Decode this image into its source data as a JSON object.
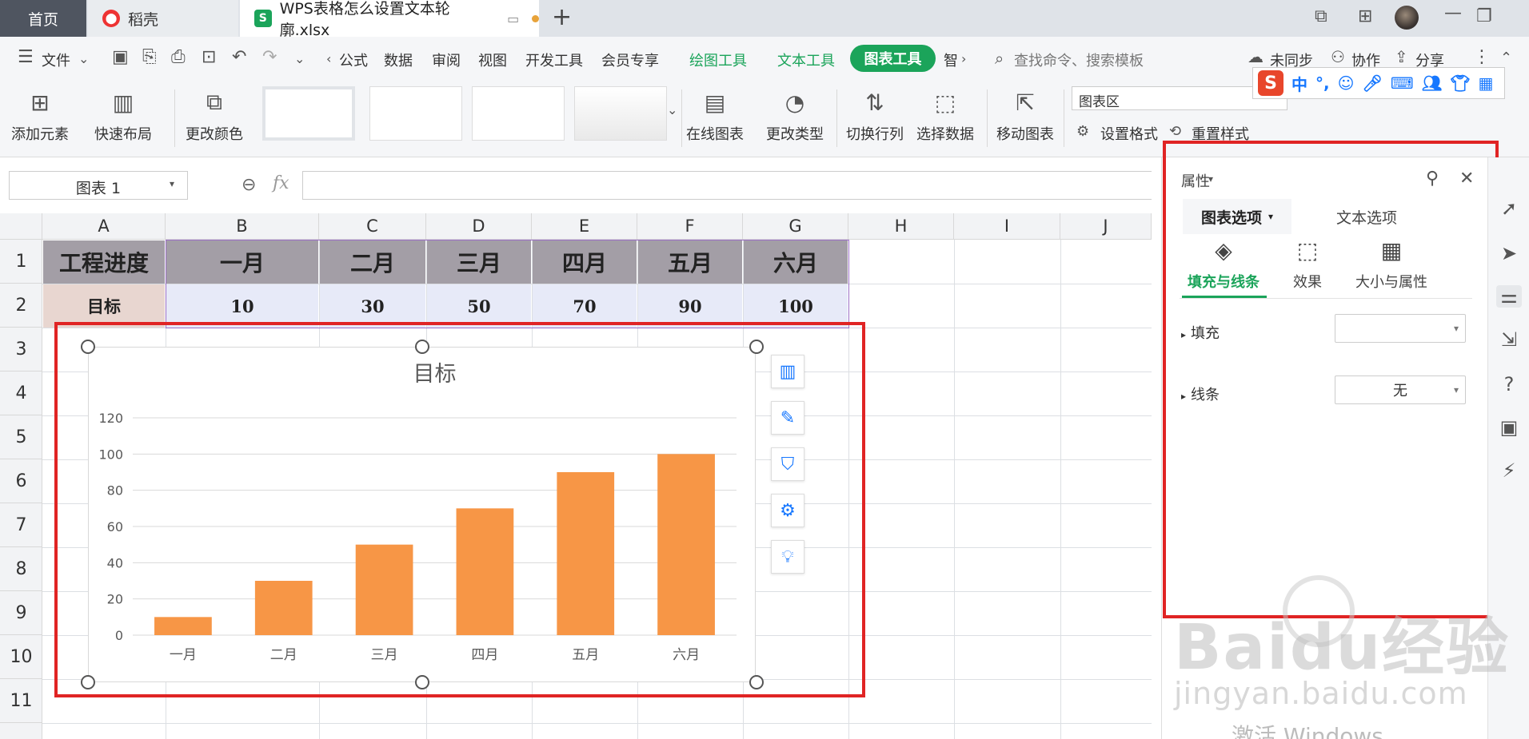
{
  "tabs": {
    "home": "首页",
    "docer": "稻壳",
    "file": "WPS表格怎么设置文本轮廓.xlsx",
    "new_tab": "+"
  },
  "menu": {
    "file": "文件",
    "items": [
      "公式",
      "数据",
      "审阅",
      "视图",
      "开发工具",
      "会员专享"
    ],
    "drawing_tools": "绘图工具",
    "text_tools": "文本工具",
    "chart_tools": "图表工具",
    "more": "智",
    "search_placeholder": "查找命令、搜索模板",
    "sync": "未同步",
    "collab": "协作",
    "share": "分享"
  },
  "ribbon": {
    "add_element": "添加元素",
    "quick_layout": "快速布局",
    "change_color": "更改颜色",
    "online_chart": "在线图表",
    "change_type": "更改类型",
    "switch_row_col": "切换行列",
    "select_data": "选择数据",
    "move_chart": "移动图表",
    "chart_area": "图表区",
    "set_format": "设置格式",
    "reset_style": "重置样式"
  },
  "ime": {
    "logo": "S",
    "lang": "中"
  },
  "formula": {
    "name_box": "图表 1",
    "fx": "fx",
    "value": ""
  },
  "grid": {
    "columns": [
      "A",
      "B",
      "C",
      "D",
      "E",
      "F",
      "G",
      "H",
      "I",
      "J"
    ],
    "rows": [
      "1",
      "2",
      "3",
      "4",
      "5",
      "6",
      "7",
      "8",
      "9",
      "10",
      "11"
    ],
    "header_row": [
      "工程进度",
      "一月",
      "二月",
      "三月",
      "四月",
      "五月",
      "六月"
    ],
    "value_row": [
      "目标",
      "10",
      "30",
      "50",
      "70",
      "90",
      "100"
    ]
  },
  "chart_data": {
    "type": "bar",
    "title": "目标",
    "categories": [
      "一月",
      "二月",
      "三月",
      "四月",
      "五月",
      "六月"
    ],
    "series": [
      {
        "values": [
          10,
          30,
          50,
          70,
          90,
          100
        ]
      }
    ],
    "ylim": [
      0,
      120
    ],
    "yticks": [
      0,
      20,
      40,
      60,
      80,
      100,
      120
    ],
    "bar_color": "#F79646",
    "grid": true,
    "legend": "none"
  },
  "panel": {
    "title": "属性",
    "tab_chart_options": "图表选项",
    "tab_text_options": "文本选项",
    "sub_fill_line": "填充与线条",
    "sub_effects": "效果",
    "sub_size_props": "大小与属性",
    "fill_label": "填充",
    "fill_value": "",
    "line_label": "线条",
    "line_value": "无"
  },
  "watermark": {
    "brand": "Baidu经验",
    "url": "jingyan.baidu.com",
    "windows": "激活 Windows"
  }
}
